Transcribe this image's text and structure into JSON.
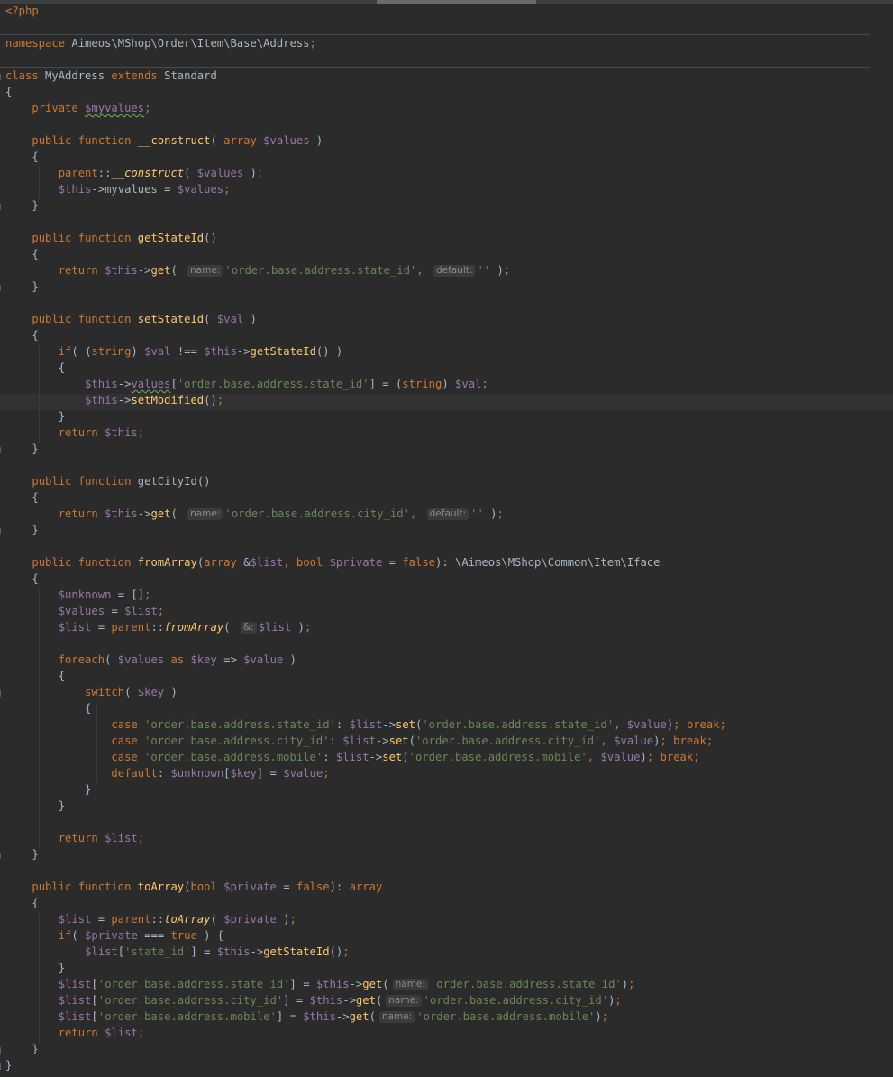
{
  "editor": {
    "colors": {
      "background": "#2b2b2b",
      "keyword": "#cc7832",
      "variable": "#9876aa",
      "string": "#6a8759",
      "function": "#ffc66d",
      "default_text": "#a9b7c6",
      "inlay_hint_text": "#8c8c8c"
    },
    "lines": [
      [
        {
          "t": "<?php",
          "c": "k"
        }
      ],
      [],
      [
        {
          "t": "namespace ",
          "c": "k"
        },
        {
          "t": "Aimeos\\MShop\\Order\\Item\\Base\\Address"
        },
        {
          "t": ";",
          "c": "k"
        }
      ],
      [],
      [
        {
          "t": "class ",
          "c": "k"
        },
        {
          "t": "MyAddress "
        },
        {
          "t": "extends ",
          "c": "k"
        },
        {
          "t": "Standard"
        }
      ],
      [
        {
          "t": "{"
        }
      ],
      [
        {
          "t": "    "
        },
        {
          "t": "private ",
          "c": "k"
        },
        {
          "t": "$myvalues",
          "c": "v wavy"
        },
        {
          "t": ";",
          "c": "k"
        }
      ],
      [],
      [
        {
          "t": "    "
        },
        {
          "t": "public function ",
          "c": "k"
        },
        {
          "t": "__construct",
          "c": "f"
        },
        {
          "t": "( "
        },
        {
          "t": "array ",
          "c": "k"
        },
        {
          "t": "$values",
          "c": "v"
        },
        {
          "t": " )"
        }
      ],
      [
        {
          "t": "    {"
        }
      ],
      [
        {
          "t": "        "
        },
        {
          "t": "parent",
          "c": "k"
        },
        {
          "t": "::"
        },
        {
          "t": "__construct",
          "c": "f it"
        },
        {
          "t": "( "
        },
        {
          "t": "$values",
          "c": "v"
        },
        {
          "t": " )"
        },
        {
          "t": ";",
          "c": "k"
        }
      ],
      [
        {
          "t": "        "
        },
        {
          "t": "$this",
          "c": "v"
        },
        {
          "t": "->myvalues = "
        },
        {
          "t": "$values",
          "c": "v"
        },
        {
          "t": ";",
          "c": "k"
        }
      ],
      [
        {
          "t": "    }"
        }
      ],
      [],
      [
        {
          "t": "    "
        },
        {
          "t": "public function ",
          "c": "k"
        },
        {
          "t": "getStateId",
          "c": "f"
        },
        {
          "t": "()"
        }
      ],
      [
        {
          "t": "    {"
        }
      ],
      [
        {
          "t": "        "
        },
        {
          "t": "return ",
          "c": "k"
        },
        {
          "t": "$this",
          "c": "v"
        },
        {
          "t": "->"
        },
        {
          "t": "get",
          "c": "f"
        },
        {
          "t": "( "
        },
        {
          "t": "name:",
          "c": "hint"
        },
        {
          "t": "'order.base.address.state_id'",
          "c": "s"
        },
        {
          "t": ", ",
          "c": "k"
        },
        {
          "t": "default:",
          "c": "hint"
        },
        {
          "t": "''",
          "c": "s"
        },
        {
          "t": " )"
        },
        {
          "t": ";",
          "c": "k"
        }
      ],
      [
        {
          "t": "    }"
        }
      ],
      [],
      [
        {
          "t": "    "
        },
        {
          "t": "public function ",
          "c": "k"
        },
        {
          "t": "setStateId",
          "c": "f"
        },
        {
          "t": "( "
        },
        {
          "t": "$val",
          "c": "v"
        },
        {
          "t": " )"
        }
      ],
      [
        {
          "t": "    {"
        }
      ],
      [
        {
          "t": "        "
        },
        {
          "t": "if",
          "c": "k"
        },
        {
          "t": "( ("
        },
        {
          "t": "string",
          "c": "k"
        },
        {
          "t": ") "
        },
        {
          "t": "$val",
          "c": "v"
        },
        {
          "t": " !== "
        },
        {
          "t": "$this",
          "c": "v"
        },
        {
          "t": "->"
        },
        {
          "t": "getStateId",
          "c": "f"
        },
        {
          "t": "() )"
        }
      ],
      [
        {
          "t": "        {"
        }
      ],
      [
        {
          "t": "            "
        },
        {
          "t": "$this",
          "c": "v"
        },
        {
          "t": "->"
        },
        {
          "t": "values",
          "c": "v wavy"
        },
        {
          "t": "["
        },
        {
          "t": "'order.base.address.state_id'",
          "c": "s"
        },
        {
          "t": "] = ("
        },
        {
          "t": "string",
          "c": "k"
        },
        {
          "t": ") "
        },
        {
          "t": "$val",
          "c": "v"
        },
        {
          "t": ";",
          "c": "k"
        }
      ],
      [
        {
          "t": "            "
        },
        {
          "t": "$this",
          "c": "v"
        },
        {
          "t": "->"
        },
        {
          "t": "setModified",
          "c": "f"
        },
        {
          "t": "()"
        },
        {
          "t": ";",
          "c": "k"
        }
      ],
      [
        {
          "t": "        }"
        }
      ],
      [
        {
          "t": "        "
        },
        {
          "t": "return ",
          "c": "k"
        },
        {
          "t": "$this",
          "c": "v"
        },
        {
          "t": ";",
          "c": "k"
        }
      ],
      [
        {
          "t": "    }"
        }
      ],
      [],
      [
        {
          "t": "    "
        },
        {
          "t": "public function ",
          "c": "k"
        },
        {
          "t": "getCityId",
          "c": "fs"
        },
        {
          "t": "()"
        }
      ],
      [
        {
          "t": "    {"
        }
      ],
      [
        {
          "t": "        "
        },
        {
          "t": "return ",
          "c": "k"
        },
        {
          "t": "$this",
          "c": "v"
        },
        {
          "t": "->"
        },
        {
          "t": "get",
          "c": "f"
        },
        {
          "t": "( "
        },
        {
          "t": "name:",
          "c": "hint"
        },
        {
          "t": "'order.base.address.city_id'",
          "c": "s"
        },
        {
          "t": ", ",
          "c": "k"
        },
        {
          "t": "default:",
          "c": "hint"
        },
        {
          "t": "''",
          "c": "s"
        },
        {
          "t": " )"
        },
        {
          "t": ";",
          "c": "k"
        }
      ],
      [
        {
          "t": "    }"
        }
      ],
      [],
      [
        {
          "t": "    "
        },
        {
          "t": "public function ",
          "c": "k"
        },
        {
          "t": "fromArray",
          "c": "f"
        },
        {
          "t": "("
        },
        {
          "t": "array ",
          "c": "k"
        },
        {
          "t": "&"
        },
        {
          "t": "$list",
          "c": "v"
        },
        {
          "t": ", ",
          "c": "k"
        },
        {
          "t": "bool ",
          "c": "k"
        },
        {
          "t": "$private",
          "c": "v"
        },
        {
          "t": " = "
        },
        {
          "t": "false",
          "c": "k"
        },
        {
          "t": "): \\Aimeos\\MShop\\Common\\Item\\Iface"
        }
      ],
      [
        {
          "t": "    {"
        }
      ],
      [
        {
          "t": "        "
        },
        {
          "t": "$unknown",
          "c": "v"
        },
        {
          "t": " = []"
        },
        {
          "t": ";",
          "c": "k"
        }
      ],
      [
        {
          "t": "        "
        },
        {
          "t": "$values",
          "c": "v"
        },
        {
          "t": " = "
        },
        {
          "t": "$list",
          "c": "v"
        },
        {
          "t": ";",
          "c": "k"
        }
      ],
      [
        {
          "t": "        "
        },
        {
          "t": "$list",
          "c": "v"
        },
        {
          "t": " = "
        },
        {
          "t": "parent",
          "c": "k"
        },
        {
          "t": "::"
        },
        {
          "t": "fromArray",
          "c": "f it"
        },
        {
          "t": "( "
        },
        {
          "t": "&:",
          "c": "hint"
        },
        {
          "t": "$list",
          "c": "v"
        },
        {
          "t": " )"
        },
        {
          "t": ";",
          "c": "k"
        }
      ],
      [],
      [
        {
          "t": "        "
        },
        {
          "t": "foreach",
          "c": "k"
        },
        {
          "t": "( "
        },
        {
          "t": "$values",
          "c": "v"
        },
        {
          "t": " as ",
          "c": "k"
        },
        {
          "t": "$key",
          "c": "v"
        },
        {
          "t": " => "
        },
        {
          "t": "$value",
          "c": "v"
        },
        {
          "t": " )"
        }
      ],
      [
        {
          "t": "        {"
        }
      ],
      [
        {
          "t": "            "
        },
        {
          "t": "switch",
          "c": "k"
        },
        {
          "t": "( "
        },
        {
          "t": "$key",
          "c": "v"
        },
        {
          "t": " )"
        }
      ],
      [
        {
          "t": "            {"
        }
      ],
      [
        {
          "t": "                "
        },
        {
          "t": "case ",
          "c": "k"
        },
        {
          "t": "'order.base.address.state_id'",
          "c": "s"
        },
        {
          "t": ": "
        },
        {
          "t": "$list",
          "c": "v"
        },
        {
          "t": "->"
        },
        {
          "t": "set",
          "c": "f"
        },
        {
          "t": "("
        },
        {
          "t": "'order.base.address.state_id'",
          "c": "s"
        },
        {
          "t": ", ",
          "c": "k"
        },
        {
          "t": "$value",
          "c": "v"
        },
        {
          "t": ")"
        },
        {
          "t": "; ",
          "c": "k"
        },
        {
          "t": "break",
          "c": "k"
        },
        {
          "t": ";",
          "c": "k"
        }
      ],
      [
        {
          "t": "                "
        },
        {
          "t": "case ",
          "c": "k"
        },
        {
          "t": "'order.base.address.city_id'",
          "c": "s"
        },
        {
          "t": ": "
        },
        {
          "t": "$list",
          "c": "v"
        },
        {
          "t": "->"
        },
        {
          "t": "set",
          "c": "f"
        },
        {
          "t": "("
        },
        {
          "t": "'order.base.address.city_id'",
          "c": "s"
        },
        {
          "t": ", ",
          "c": "k"
        },
        {
          "t": "$value",
          "c": "v"
        },
        {
          "t": ")"
        },
        {
          "t": "; ",
          "c": "k"
        },
        {
          "t": "break",
          "c": "k"
        },
        {
          "t": ";",
          "c": "k"
        }
      ],
      [
        {
          "t": "                "
        },
        {
          "t": "case ",
          "c": "k"
        },
        {
          "t": "'order.base.address.mobile'",
          "c": "s"
        },
        {
          "t": ": "
        },
        {
          "t": "$list",
          "c": "v"
        },
        {
          "t": "->"
        },
        {
          "t": "set",
          "c": "f"
        },
        {
          "t": "("
        },
        {
          "t": "'order.base.address.mobile'",
          "c": "s"
        },
        {
          "t": ", ",
          "c": "k"
        },
        {
          "t": "$value",
          "c": "v"
        },
        {
          "t": ")"
        },
        {
          "t": "; ",
          "c": "k"
        },
        {
          "t": "break",
          "c": "k"
        },
        {
          "t": ";",
          "c": "k"
        }
      ],
      [
        {
          "t": "                "
        },
        {
          "t": "default",
          "c": "k"
        },
        {
          "t": ": "
        },
        {
          "t": "$unknown",
          "c": "v"
        },
        {
          "t": "["
        },
        {
          "t": "$key",
          "c": "v"
        },
        {
          "t": "] = "
        },
        {
          "t": "$value",
          "c": "v"
        },
        {
          "t": ";",
          "c": "k"
        }
      ],
      [
        {
          "t": "            }"
        }
      ],
      [
        {
          "t": "        }"
        }
      ],
      [],
      [
        {
          "t": "        "
        },
        {
          "t": "return ",
          "c": "k"
        },
        {
          "t": "$list",
          "c": "v"
        },
        {
          "t": ";",
          "c": "k"
        }
      ],
      [
        {
          "t": "    }"
        }
      ],
      [],
      [
        {
          "t": "    "
        },
        {
          "t": "public function ",
          "c": "k"
        },
        {
          "t": "toArray",
          "c": "f"
        },
        {
          "t": "("
        },
        {
          "t": "bool ",
          "c": "k"
        },
        {
          "t": "$private",
          "c": "v"
        },
        {
          "t": " = "
        },
        {
          "t": "false",
          "c": "k"
        },
        {
          "t": "): "
        },
        {
          "t": "array",
          "c": "k"
        }
      ],
      [
        {
          "t": "    {"
        }
      ],
      [
        {
          "t": "        "
        },
        {
          "t": "$list",
          "c": "v"
        },
        {
          "t": " = "
        },
        {
          "t": "parent",
          "c": "k"
        },
        {
          "t": "::"
        },
        {
          "t": "toArray",
          "c": "f it"
        },
        {
          "t": "( "
        },
        {
          "t": "$private",
          "c": "v"
        },
        {
          "t": " )"
        },
        {
          "t": ";",
          "c": "k"
        }
      ],
      [
        {
          "t": "        "
        },
        {
          "t": "if",
          "c": "k"
        },
        {
          "t": "( "
        },
        {
          "t": "$private",
          "c": "v"
        },
        {
          "t": " === "
        },
        {
          "t": "true",
          "c": "k"
        },
        {
          "t": " ) {"
        }
      ],
      [
        {
          "t": "            "
        },
        {
          "t": "$list",
          "c": "v"
        },
        {
          "t": "["
        },
        {
          "t": "'state_id'",
          "c": "s"
        },
        {
          "t": "] = "
        },
        {
          "t": "$this",
          "c": "v"
        },
        {
          "t": "->"
        },
        {
          "t": "getStateId",
          "c": "f"
        },
        {
          "t": "()"
        },
        {
          "t": ";",
          "c": "k"
        }
      ],
      [
        {
          "t": "        }"
        }
      ],
      [
        {
          "t": "        "
        },
        {
          "t": "$list",
          "c": "v"
        },
        {
          "t": "["
        },
        {
          "t": "'order.base.address.state_id'",
          "c": "s"
        },
        {
          "t": "] = "
        },
        {
          "t": "$this",
          "c": "v"
        },
        {
          "t": "->"
        },
        {
          "t": "get",
          "c": "f"
        },
        {
          "t": "("
        },
        {
          "t": "name:",
          "c": "hint"
        },
        {
          "t": "'order.base.address.state_id'",
          "c": "s"
        },
        {
          "t": ")"
        },
        {
          "t": ";",
          "c": "k"
        }
      ],
      [
        {
          "t": "        "
        },
        {
          "t": "$list",
          "c": "v"
        },
        {
          "t": "["
        },
        {
          "t": "'order.base.address.city_id'",
          "c": "s"
        },
        {
          "t": "] = "
        },
        {
          "t": "$this",
          "c": "v"
        },
        {
          "t": "->"
        },
        {
          "t": "get",
          "c": "f"
        },
        {
          "t": "("
        },
        {
          "t": "name:",
          "c": "hint"
        },
        {
          "t": "'order.base.address.city_id'",
          "c": "s"
        },
        {
          "t": ")"
        },
        {
          "t": ";",
          "c": "k"
        }
      ],
      [
        {
          "t": "        "
        },
        {
          "t": "$list",
          "c": "v"
        },
        {
          "t": "["
        },
        {
          "t": "'order.base.address.mobile'",
          "c": "s"
        },
        {
          "t": "] = "
        },
        {
          "t": "$this",
          "c": "v"
        },
        {
          "t": "->"
        },
        {
          "t": "get",
          "c": "f"
        },
        {
          "t": "("
        },
        {
          "t": "name:",
          "c": "hint"
        },
        {
          "t": "'order.base.address.mobile'",
          "c": "s"
        },
        {
          "t": ")"
        },
        {
          "t": ";",
          "c": "k"
        }
      ],
      [
        {
          "t": "        "
        },
        {
          "t": "return ",
          "c": "k"
        },
        {
          "t": "$list",
          "c": "v"
        },
        {
          "t": ";",
          "c": "k"
        }
      ],
      [
        {
          "t": "    }"
        }
      ],
      [
        {
          "t": "}"
        }
      ]
    ]
  }
}
